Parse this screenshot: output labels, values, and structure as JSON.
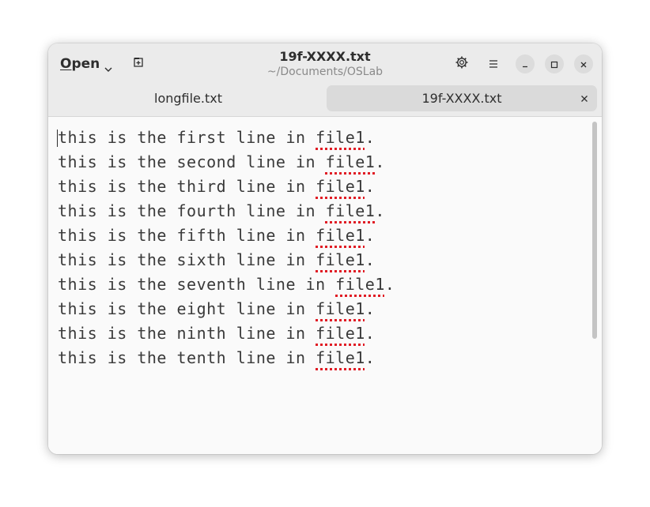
{
  "header": {
    "open_label_mnemonic": "O",
    "open_label_rest": "pen",
    "title": "19f-XXXX.txt",
    "subtitle": "~/Documents/OSLab"
  },
  "tabs": [
    {
      "label": "longfile.txt",
      "active": false
    },
    {
      "label": "19f-XXXX.txt",
      "active": true
    }
  ],
  "editor": {
    "lines": [
      {
        "pre": "this is the first line in ",
        "word": "file1",
        "post": "."
      },
      {
        "pre": "this is the second line in ",
        "word": "file1",
        "post": "."
      },
      {
        "pre": "this is the third line in ",
        "word": "file1",
        "post": "."
      },
      {
        "pre": "this is the fourth line in ",
        "word": "file1",
        "post": "."
      },
      {
        "pre": "this is the fifth line in ",
        "word": "file1",
        "post": "."
      },
      {
        "pre": "this is the sixth line in ",
        "word": "file1",
        "post": "."
      },
      {
        "pre": "this is the seventh line in ",
        "word": "file1",
        "post": "."
      },
      {
        "pre": "this is the eight line in ",
        "word": "file1",
        "post": "."
      },
      {
        "pre": "this is the ninth line in ",
        "word": "file1",
        "post": "."
      },
      {
        "pre": "this is the tenth line in ",
        "word": "file1",
        "post": "."
      }
    ]
  },
  "colors": {
    "spellcheck_underline": "#e01b24",
    "headerbar_bg": "#ebebeb",
    "active_tab_bg": "#dadada"
  },
  "icons": {
    "open_dropdown": "chevron-down-icon",
    "new_tab": "new-tab-icon",
    "document_settings": "gear-icon",
    "menu": "hamburger-menu-icon",
    "minimize": "minimize-icon",
    "maximize": "maximize-icon",
    "close": "close-icon",
    "tab_close": "close-icon"
  }
}
